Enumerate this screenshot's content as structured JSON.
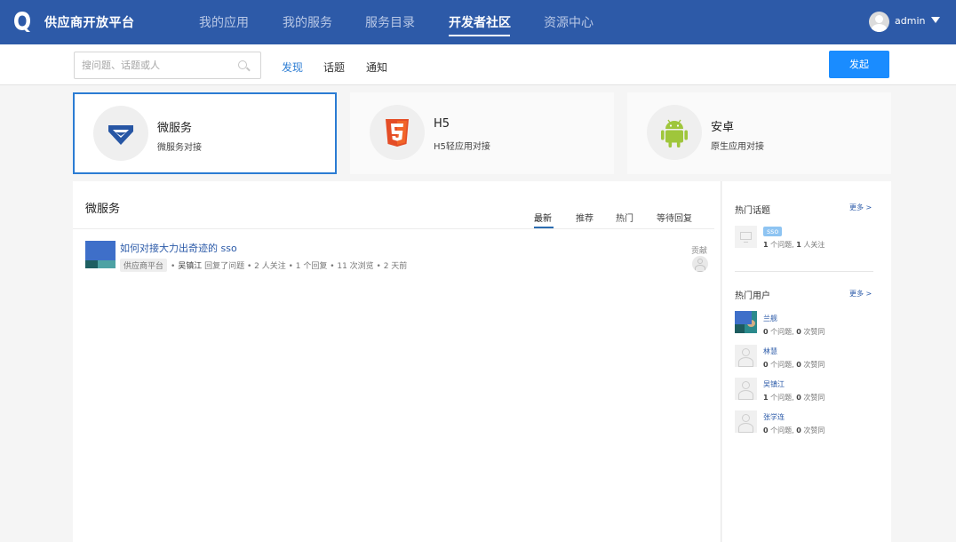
{
  "header": {
    "brand": "供应商开放平台",
    "nav": [
      "我的应用",
      "我的服务",
      "服务目录",
      "开发者社区",
      "资源中心"
    ],
    "active_nav": "开发者社区",
    "user": "admin"
  },
  "subbar": {
    "search_placeholder": "搜问题、话题或人",
    "tabs": [
      "发现",
      "话题",
      "通知"
    ],
    "active_tab": "发现",
    "action_button": "发起"
  },
  "categories": [
    {
      "title": "微服务",
      "desc": "微服务对接",
      "icon": "shield-diamond-icon",
      "selected": true
    },
    {
      "title": "H5",
      "desc": "H5轻应用对接",
      "icon": "html5-icon",
      "selected": false
    },
    {
      "title": "安卓",
      "desc": "原生应用对接",
      "icon": "android-icon",
      "selected": false
    }
  ],
  "main": {
    "title": "微服务",
    "tabs": [
      "最新",
      "推荐",
      "热门",
      "等待回复"
    ],
    "active_tab": "最新",
    "questions": [
      {
        "title": "如何对接大力出奇迹的 sso",
        "tag": "供应商平台",
        "author": "吴镇江",
        "action": "回复了问题",
        "stats": "• 2 人关注 • 1 个回复 • 11 次浏览 • 2 天前",
        "contrib_label": "贡献"
      }
    ]
  },
  "sidebar": {
    "topics_heading": "热门话题",
    "topics_more": "更多 >",
    "topic": {
      "badge": "sso",
      "q_count": "1",
      "q_label": " 个问题, ",
      "f_count": "1",
      "f_label": " 人关注"
    },
    "users_heading": "热门用户",
    "users_more": "更多 >",
    "users": [
      {
        "name": "兰舰",
        "q": "0",
        "q_label": " 个问题, ",
        "v": "0",
        "v_label": " 次赞同"
      },
      {
        "name": "林慧",
        "q": "0",
        "q_label": " 个问题, ",
        "v": "0",
        "v_label": " 次赞同"
      },
      {
        "name": "吴镇江",
        "q": "1",
        "q_label": " 个问题, ",
        "v": "0",
        "v_label": " 次赞同"
      },
      {
        "name": "张学连",
        "q": "0",
        "q_label": " 个问题, ",
        "v": "0",
        "v_label": " 次赞同"
      }
    ]
  },
  "colors": {
    "header_bg": "#2d5aa8",
    "accent": "#1a8cff",
    "link": "#2b5aa8"
  }
}
